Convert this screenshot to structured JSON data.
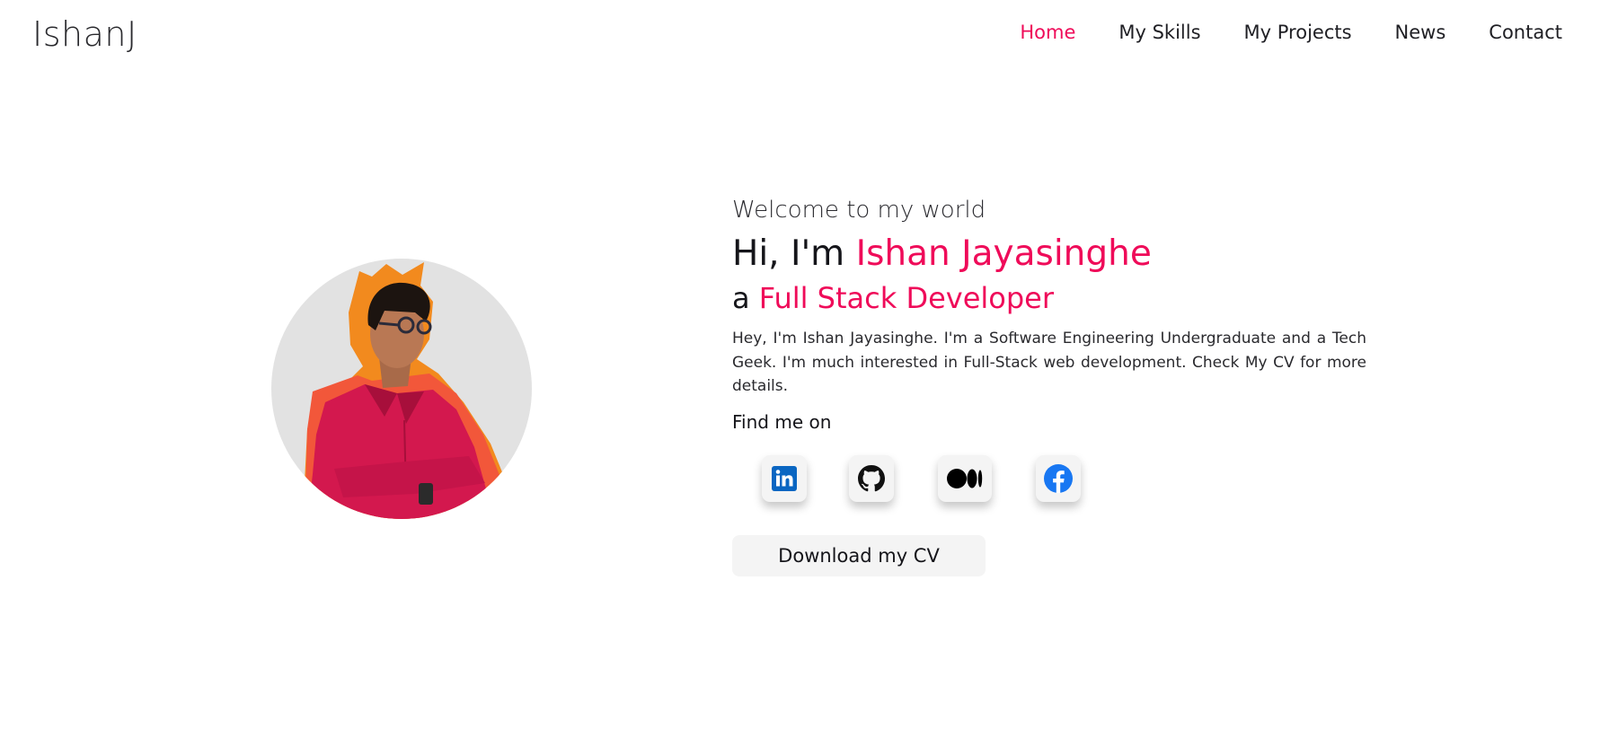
{
  "header": {
    "logo": "IshanJ",
    "nav": [
      {
        "label": "Home",
        "active": true
      },
      {
        "label": "My Skills",
        "active": false
      },
      {
        "label": "My Projects",
        "active": false
      },
      {
        "label": "News",
        "active": false
      },
      {
        "label": "Contact",
        "active": false
      }
    ]
  },
  "hero": {
    "welcome": "Welcome to my world",
    "greeting_prefix": "Hi, I'm ",
    "name": "Ishan Jayasinghe",
    "role_prefix": "a ",
    "role": "Full Stack Developer",
    "bio": "Hey, I'm Ishan Jayasinghe. I'm a Software Engineering Undergraduate and a Tech Geek. I'm much interested in Full-Stack web development. Check My CV for more details.",
    "find_me": "Find me on",
    "socials": [
      {
        "name": "LinkedIn",
        "icon": "linkedin-icon",
        "color": "#0a66c2"
      },
      {
        "name": "GitHub",
        "icon": "github-icon",
        "color": "#111111"
      },
      {
        "name": "Medium",
        "icon": "medium-icon",
        "color": "#000000"
      },
      {
        "name": "Facebook",
        "icon": "facebook-icon",
        "color": "#1877f2"
      }
    ],
    "cv_button": "Download my CV"
  },
  "colors": {
    "accent": "#ef0b59",
    "text": "#15151a",
    "avatar_bg": "#e2e2e2",
    "button_bg": "#f4f4f4"
  }
}
